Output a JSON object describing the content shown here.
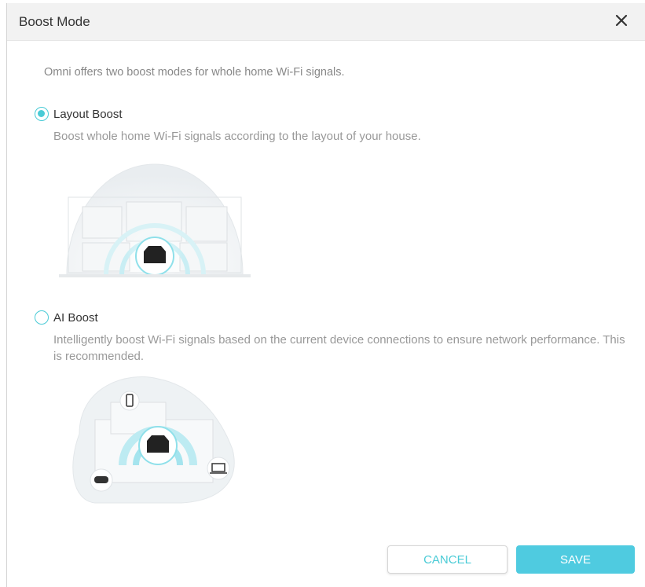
{
  "dialog": {
    "title": "Boost Mode",
    "close_icon": "close-icon",
    "intro": "Omni offers two boost modes for whole home Wi-Fi signals."
  },
  "options": [
    {
      "label": "Layout Boost",
      "description": "Boost whole home Wi-Fi signals according to the layout of your house.",
      "selected": true,
      "illustration": "house-layout-router-illustration"
    },
    {
      "label": "AI Boost",
      "description": "Intelligently boost Wi-Fi signals based on the current device connections to ensure network performance. This is recommended.",
      "selected": false,
      "illustration": "ai-boost-devices-illustration"
    }
  ],
  "buttons": {
    "cancel": "CANCEL",
    "save": "SAVE"
  },
  "colors": {
    "accent": "#4acbd6",
    "save_button": "#4fcbe0",
    "header_bg": "#f2f2f2"
  }
}
